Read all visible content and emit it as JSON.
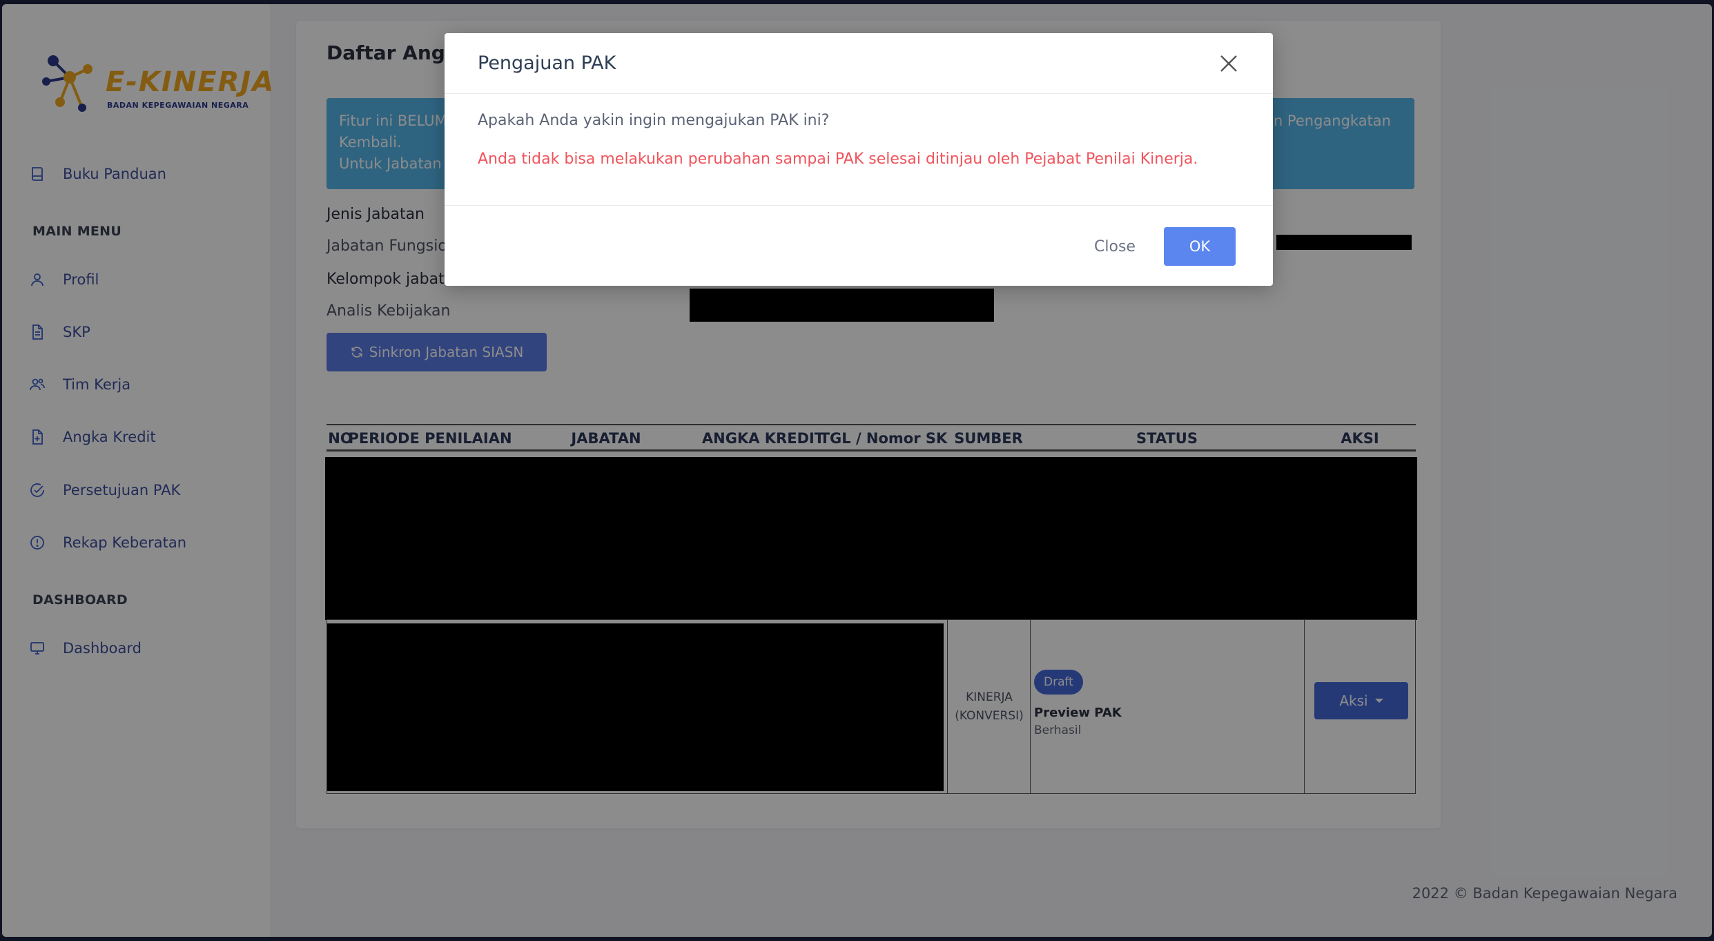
{
  "brand": {
    "name": "E-KINERJA",
    "subtitle": "BADAN KEPEGAWAIAN NEGARA"
  },
  "sidebar": {
    "top_item": {
      "label": "Buku Panduan",
      "icon": "book-icon"
    },
    "main_menu_heading": "MAIN MENU",
    "main_items": [
      {
        "label": "Profil",
        "icon": "user-icon"
      },
      {
        "label": "SKP",
        "icon": "document-icon"
      },
      {
        "label": "Tim Kerja",
        "icon": "users-icon"
      },
      {
        "label": "Angka Kredit",
        "icon": "file-plus-icon"
      },
      {
        "label": "Persetujuan PAK",
        "icon": "check-circle-icon"
      },
      {
        "label": "Rekap Keberatan",
        "icon": "alert-circle-icon"
      }
    ],
    "dashboard_heading": "DASHBOARD",
    "dashboard_items": [
      {
        "label": "Dashboard",
        "icon": "monitor-icon"
      }
    ]
  },
  "main": {
    "page_title": "Daftar Angka",
    "alert": {
      "line1": "Fitur ini BELUM",
      "line2": "Kembali.",
      "line3": "Untuk Jabatan F",
      "line1_right": "an Pengangkatan"
    },
    "fields": {
      "jenis_jabatan_label": "Jenis Jabatan",
      "jenis_jabatan_value": "Jabatan Fungsion",
      "kelompok_label": "Kelompok jabata",
      "kelompok_value": "Analis Kebijakan"
    },
    "sync_button_label": "Sinkron Jabatan SIASN",
    "table": {
      "headers": [
        "NO",
        "PERIODE PENILAIAN",
        "JABATAN",
        "ANGKA KREDIT",
        "TGL / Nomor SK",
        "SUMBER",
        "STATUS",
        "AKSI"
      ],
      "row": {
        "sumber_line1": "KINERJA",
        "sumber_line2": "(KONVERSI)",
        "status_badge": "Draft",
        "status_title": "Preview PAK",
        "status_sub": "Berhasil",
        "aksi_label": "Aksi"
      }
    }
  },
  "footer": "2022 © Badan Kepegawaian Negara",
  "modal": {
    "title": "Pengajuan PAK",
    "question": "Apakah Anda yakin ingin mengajukan PAK ini?",
    "warning": "Anda tidak bisa melakukan perubahan sampai PAK selesai ditinjau oleh Pejabat Penilai Kinerja.",
    "close_label": "Close",
    "ok_label": "OK"
  },
  "colors": {
    "primary": "#4668d9",
    "alert": "#56b6ec",
    "warning": "#f0545c",
    "brand_orange": "#f1a81f"
  }
}
